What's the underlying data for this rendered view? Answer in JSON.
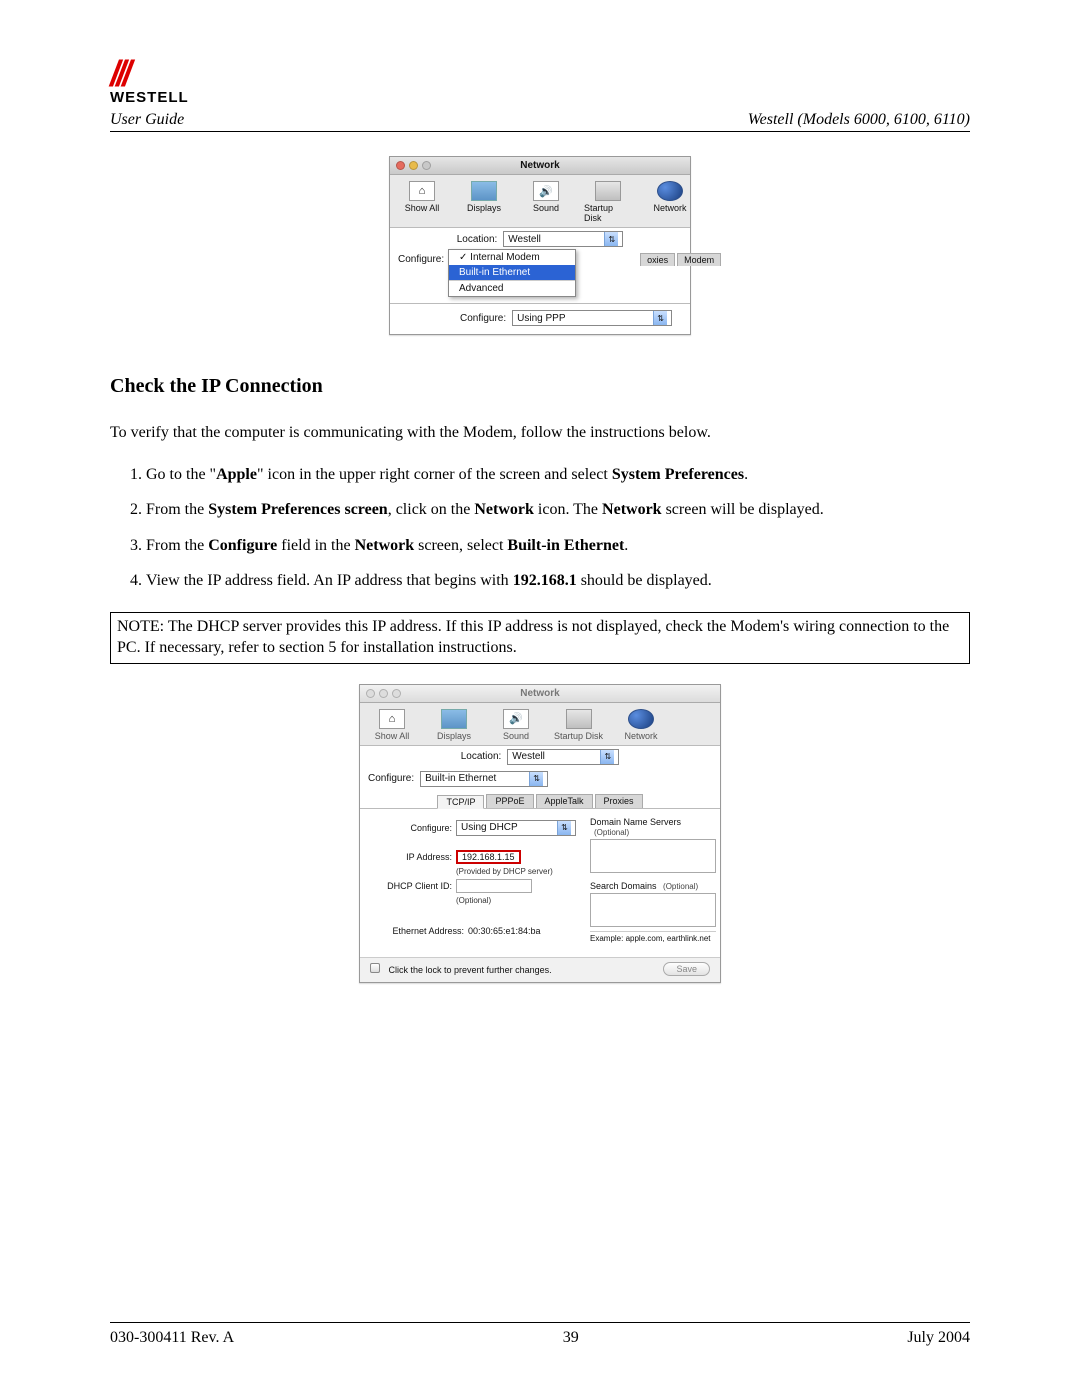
{
  "header": {
    "brand": "WESTELL",
    "user_guide": "User Guide",
    "models": "Westell (Models 6000, 6100, 6110)"
  },
  "screenshot1": {
    "title": "Network",
    "toolbar": {
      "show_all": "Show All",
      "displays": "Displays",
      "sound": "Sound",
      "startup_disk": "Startup Disk",
      "network": "Network"
    },
    "location_label": "Location:",
    "location_value": "Westell",
    "configure_label": "Configure:",
    "configure_options": {
      "internal_modem": "Internal Modem",
      "built_in_ethernet": "Built-in Ethernet",
      "advanced": "Advanced"
    },
    "tabs": {
      "oxies": "oxies",
      "modem": "Modem"
    },
    "configure2_label": "Configure:",
    "configure2_value": "Using PPP"
  },
  "section_title": "Check the IP Connection",
  "intro": "To verify that the computer is communicating with the Modem, follow the instructions below.",
  "steps": {
    "s1a": "Go to the \"",
    "s1b": "Apple",
    "s1c": "\" icon in the upper right corner of the screen and select ",
    "s1d": "System Preferences",
    "s1e": ".",
    "s2a": "From the ",
    "s2b": "System Preferences screen",
    "s2c": ", click on the ",
    "s2d": "Network",
    "s2e": " icon. The ",
    "s2f": "Network",
    "s2g": " screen will be displayed.",
    "s3a": "From the ",
    "s3b": "Configure",
    "s3c": " field in the ",
    "s3d": "Network",
    "s3e": " screen, select ",
    "s3f": "Built-in Ethernet",
    "s3g": ".",
    "s4a": "View the IP address field. An IP address that begins with ",
    "s4b": "192.168.1",
    "s4c": " should be displayed."
  },
  "note": "NOTE: The DHCP server provides this IP address. If this IP address is not displayed, check the Modem's wiring connection to the PC. If necessary, refer to section 5 for installation instructions.",
  "screenshot2": {
    "title": "Network",
    "toolbar": {
      "show_all": "Show All",
      "displays": "Displays",
      "sound": "Sound",
      "startup_disk": "Startup Disk",
      "network": "Network"
    },
    "location_label": "Location:",
    "location_value": "Westell",
    "configure_label": "Configure:",
    "configure_value": "Built-in Ethernet",
    "tabs": {
      "tcpip": "TCP/IP",
      "pppoe": "PPPoE",
      "appletalk": "AppleTalk",
      "proxies": "Proxies"
    },
    "configure2_label": "Configure:",
    "configure2_value": "Using DHCP",
    "ip_label": "IP Address:",
    "ip_value": "192.168.1.15",
    "ip_hint": "(Provided by DHCP server)",
    "dhcp_client_label": "DHCP Client ID:",
    "dhcp_client_hint": "(Optional)",
    "eth_label": "Ethernet Address:",
    "eth_value": "00:30:65:e1:84:ba",
    "dns_label": "Domain Name Servers",
    "dns_opt": "(Optional)",
    "search_label": "Search Domains",
    "search_opt": "(Optional)",
    "example": "Example: apple.com, earthlink.net",
    "lock_text": "Click the lock to prevent further changes.",
    "save": "Save"
  },
  "footer": {
    "rev": "030-300411 Rev. A",
    "page": "39",
    "date": "July 2004"
  }
}
